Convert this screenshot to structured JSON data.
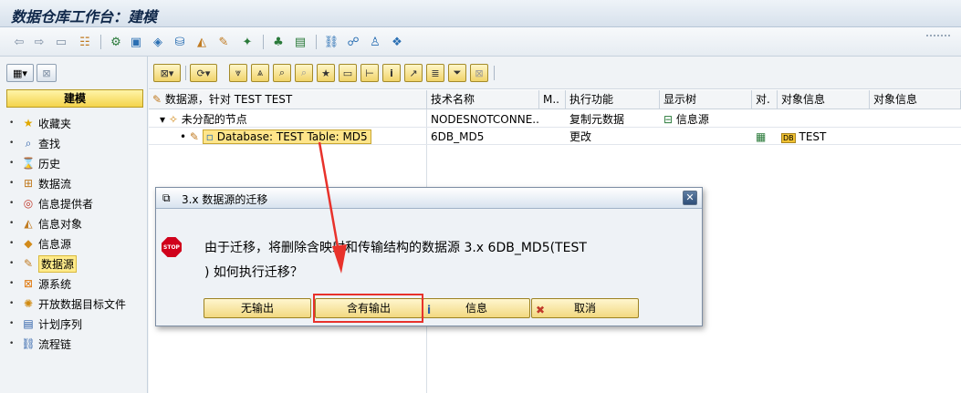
{
  "window": {
    "title": "数据仓库工作台：建模"
  },
  "left_panel": {
    "header": "建模",
    "items": [
      {
        "label": "收藏夹",
        "icon": "star-icon"
      },
      {
        "label": "查找",
        "icon": "binoculars-icon"
      },
      {
        "label": "历史",
        "icon": "history-icon"
      },
      {
        "label": "数据流",
        "icon": "dataflow-icon"
      },
      {
        "label": "信息提供者",
        "icon": "target-icon"
      },
      {
        "label": "信息对象",
        "icon": "infoobject-icon"
      },
      {
        "label": "信息源",
        "icon": "infosource-icon"
      },
      {
        "label": "数据源",
        "icon": "datasource-icon"
      },
      {
        "label": "源系统",
        "icon": "sourcesystem-icon"
      },
      {
        "label": "开放数据目标文件",
        "icon": "openhub-icon"
      },
      {
        "label": "计划序列",
        "icon": "processchain-icon"
      },
      {
        "label": "流程链",
        "icon": "chain-link-icon"
      }
    ]
  },
  "table": {
    "columns": [
      "数据源，针对 TEST TEST",
      "技术名称",
      "M..",
      "执行功能",
      "显示树",
      "对.",
      "对象信息",
      "对象信息"
    ],
    "rows": [
      {
        "name": "未分配的节点",
        "tech": "NODESNOTCONNE...",
        "exec": "复制元数据",
        "tree": "信息源",
        "obj": ""
      },
      {
        "name": "Database: TEST Table: MD5",
        "tech": "6DB_MD5",
        "exec": "更改",
        "tree": "",
        "obj": "TEST"
      }
    ]
  },
  "dialog": {
    "title": "3.x 数据源的迁移",
    "stop_label": "STOP",
    "message_line1": "由于迁移，将删除含映射和传输结构的数据源 3.x 6DB_MD5(TEST",
    "message_line2": ") 如何执行迁移？",
    "buttons": {
      "no_output": "无输出",
      "with_output": "含有输出",
      "info": "信息",
      "cancel": "取消"
    }
  },
  "colors": {
    "accent_highlight": "#ffe58a",
    "annotation_red": "#e8322b"
  }
}
